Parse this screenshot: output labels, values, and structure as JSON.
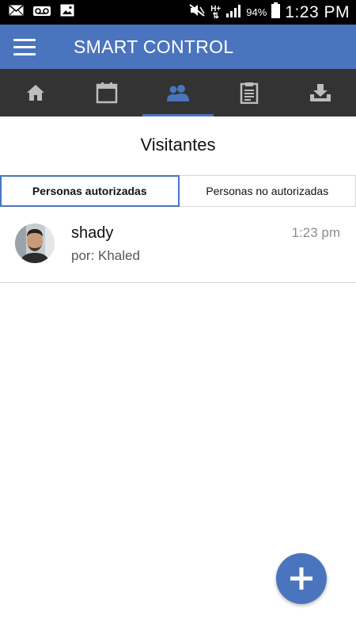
{
  "status_bar": {
    "battery": "94%",
    "time": "1:23 PM",
    "network": "H+"
  },
  "app_bar": {
    "title": "SMART CONTROL"
  },
  "tabs": [
    {
      "icon": "home-icon"
    },
    {
      "icon": "calendar-icon"
    },
    {
      "icon": "people-icon",
      "active": true
    },
    {
      "icon": "clipboard-icon"
    },
    {
      "icon": "download-icon"
    }
  ],
  "page": {
    "title": "Visitantes",
    "segments": [
      {
        "label": "Personas autorizadas",
        "active": true
      },
      {
        "label": "Personas no autorizadas",
        "active": false
      }
    ]
  },
  "visitors": [
    {
      "name": "shady",
      "by": "por: Khaled",
      "time": "1:23 pm"
    }
  ],
  "colors": {
    "primary": "#4a74bd",
    "tab_bar": "#333333"
  }
}
